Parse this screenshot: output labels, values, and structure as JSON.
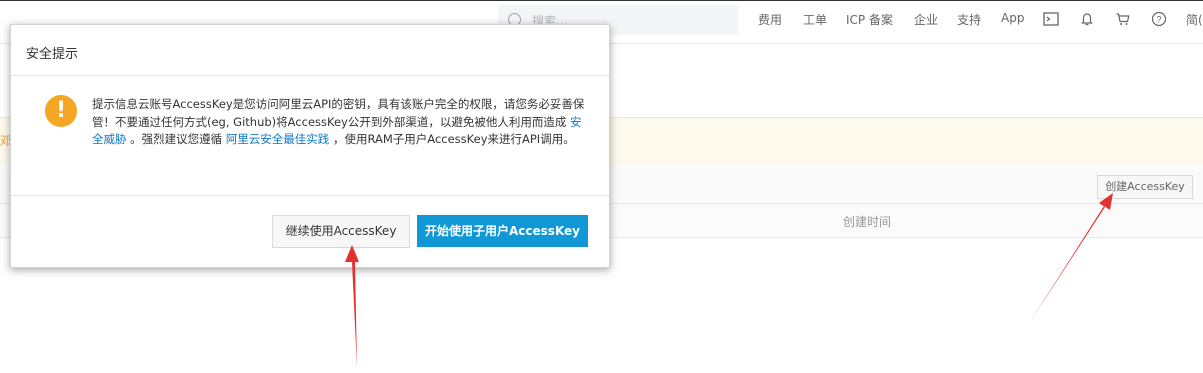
{
  "topbar": {
    "search_placeholder": "搜索...",
    "nav": [
      "费用",
      "工单",
      "ICP 备案",
      "企业",
      "支持",
      "App"
    ],
    "right_cut": "简("
  },
  "banner": {
    "edge_text": "邓"
  },
  "toolbar": {
    "create_button": "创建AccessKey"
  },
  "table": {
    "header_time": "创建时间"
  },
  "modal": {
    "title": "安全提示",
    "warn_symbol": "!",
    "msg_part1": "提示信息云账号AccessKey是您访问阿里云API的密钥，具有该账户完全的权限，请您务必妥善保管！不要通过任何方式(eg, Github)将AccessKey公开到外部渠道，以避免被他人利用而造成 ",
    "link1": "安全威胁",
    "msg_part2": " 。强烈建议您遵循 ",
    "link2": "阿里云安全最佳实践",
    "msg_part3": " ，使用RAM子用户AccessKey来进行API调用。",
    "continue_button": "继续使用AccessKey",
    "start_button": "开始使用子用户AccessKey"
  },
  "icons": [
    "search-icon",
    "terminal-icon",
    "bell-icon",
    "cart-icon",
    "help-icon",
    "warning-icon"
  ],
  "colors": {
    "primary": "#0f97d6",
    "link": "#0b78c8",
    "warning": "#f5a623",
    "arrow": "#e5312f"
  }
}
